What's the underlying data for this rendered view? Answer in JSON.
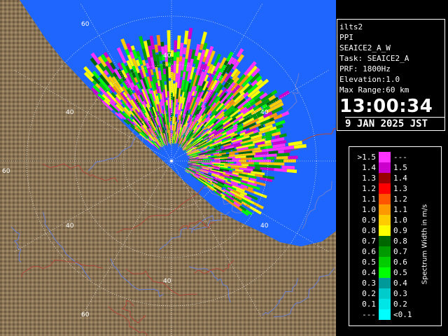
{
  "info": {
    "station": "ilts2",
    "mode": "PPI",
    "scan": "SEAICE2_A_W",
    "task": "Task: SEAICE2_A",
    "prf": "PRF: 1800Hz",
    "elevation": "Elevation:1.0",
    "max_range": "Max Range:60 km",
    "time": "13:00:34",
    "date": "9 JAN 2025 JST"
  },
  "colors": {
    "sea": "#1f66ff",
    "land": "#8a7455",
    "land_dark": "#3d3020",
    "river": "#6a7fd0",
    "boundary": "#b04a3a",
    "ring": "#ffffff"
  },
  "range_rings": {
    "radii_km": [
      20,
      40,
      60
    ],
    "labels": [
      "40",
      "60",
      "40",
      "60",
      "40",
      "40",
      "40",
      "60",
      "40"
    ]
  },
  "scale": {
    "unit_label": "Spectrum Width in m/s",
    "rows": [
      {
        "lo": ">1.5",
        "hi": "---",
        "color": "#ff33ff"
      },
      {
        "lo": "1.4",
        "hi": "1.5",
        "color": "#cc00cc"
      },
      {
        "lo": "1.3",
        "hi": "1.4",
        "color": "#990000"
      },
      {
        "lo": "1.2",
        "hi": "1.3",
        "color": "#ff0000"
      },
      {
        "lo": "1.1",
        "hi": "1.2",
        "color": "#ff5500"
      },
      {
        "lo": "1.0",
        "hi": "1.1",
        "color": "#ff9900"
      },
      {
        "lo": "0.9",
        "hi": "1.0",
        "color": "#ffcc00"
      },
      {
        "lo": "0.8",
        "hi": "0.9",
        "color": "#ffff00"
      },
      {
        "lo": "0.7",
        "hi": "0.8",
        "color": "#006600"
      },
      {
        "lo": "0.6",
        "hi": "0.7",
        "color": "#009900"
      },
      {
        "lo": "0.5",
        "hi": "0.6",
        "color": "#00cc00"
      },
      {
        "lo": "0.4",
        "hi": "0.5",
        "color": "#00ff00"
      },
      {
        "lo": "0.3",
        "hi": "0.4",
        "color": "#009999"
      },
      {
        "lo": "0.2",
        "hi": "0.3",
        "color": "#00cccc"
      },
      {
        "lo": "0.1",
        "hi": "0.2",
        "color": "#00e6e6"
      },
      {
        "lo": "---",
        "hi": "<0.1",
        "color": "#00ffff"
      }
    ]
  }
}
